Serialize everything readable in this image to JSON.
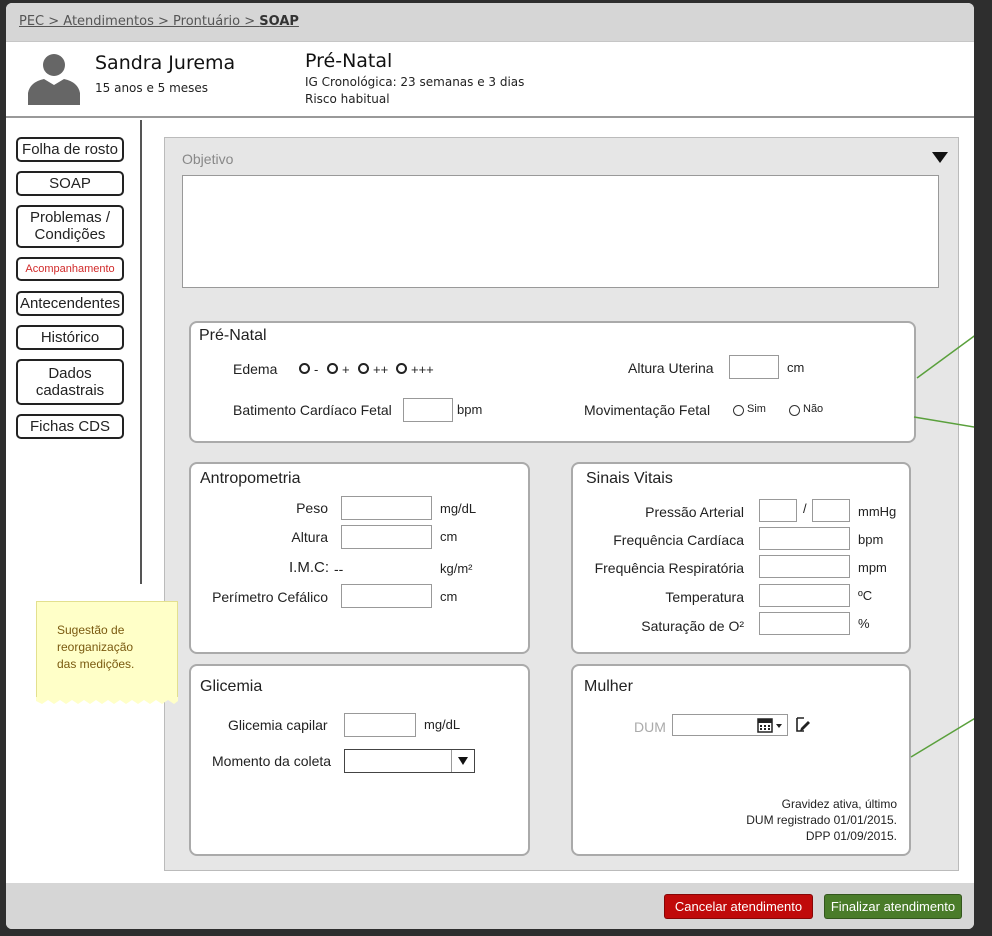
{
  "breadcrumb": {
    "part1": "PEC > Atendimentos > Prontuário > ",
    "current": "SOAP"
  },
  "patient": {
    "name": "Sandra Jurema",
    "age": "15 anos e 5 meses"
  },
  "context": {
    "title": "Pré-Natal",
    "ig": "IG Cronológica: 23 semanas e 3 dias",
    "risk": "Risco habitual"
  },
  "nav": {
    "items": [
      {
        "label": "Folha de rosto"
      },
      {
        "label": "SOAP"
      },
      {
        "label": "Problemas / Condições"
      },
      {
        "label": "Acompanhamento"
      },
      {
        "label": "Antecendentes"
      },
      {
        "label": "Histórico"
      },
      {
        "label": "Dados cadastrais"
      },
      {
        "label": "Fichas CDS"
      }
    ]
  },
  "objetivo": {
    "label": "Objetivo",
    "text": ""
  },
  "prenatal": {
    "title": "Pré-Natal",
    "edema_label": "Edema",
    "edema_options": [
      "-",
      "+",
      "++",
      "+++"
    ],
    "altura_uterina_label": "Altura Uterina",
    "altura_uterina_unit": "cm",
    "bcf_label": "Batimento Cardíaco Fetal",
    "bcf_unit": "bpm",
    "mov_label": "Movimentação Fetal",
    "mov_options": [
      "Sim",
      "Não"
    ]
  },
  "antropometria": {
    "title": "Antropometria",
    "peso_label": "Peso",
    "peso_unit": "mg/dL",
    "altura_label": "Altura",
    "altura_unit": "cm",
    "imc_label": "I.M.C:",
    "imc_value": "--",
    "imc_unit": "kg/m²",
    "pc_label": "Perímetro Cefálico",
    "pc_unit": "cm"
  },
  "sinais": {
    "title": "Sinais Vitais",
    "pa_label": "Pressão Arterial",
    "pa_sep": "/",
    "pa_unit": "mmHg",
    "fc_label": "Frequência Cardíaca",
    "fc_unit": "bpm",
    "fr_label": "Frequência Respiratória",
    "fr_unit": "mpm",
    "temp_label": "Temperatura",
    "temp_unit": "ºC",
    "sat_label": "Saturação de O²",
    "sat_unit": "%"
  },
  "glicemia": {
    "title": "Glicemia",
    "gc_label": "Glicemia capilar",
    "gc_unit": "mg/dL",
    "mc_label": "Momento da coleta"
  },
  "mulher": {
    "title": "Mulher",
    "dum_label": "DUM",
    "note_line1": "Gravidez ativa, último",
    "note_line2": "DUM registrado 01/01/2015.",
    "note_line3": "DPP 01/09/2015."
  },
  "sticky_note": {
    "line1": "Sugestão de",
    "line2": "reorganização",
    "line3": "das medições."
  },
  "footer": {
    "cancel": "Cancelar atendimento",
    "finish": "Finalizar atendimento"
  },
  "colors": {
    "cancel": "#c00a0a",
    "finish": "#4a7c2a",
    "annotation_line": "#5aa03c"
  }
}
